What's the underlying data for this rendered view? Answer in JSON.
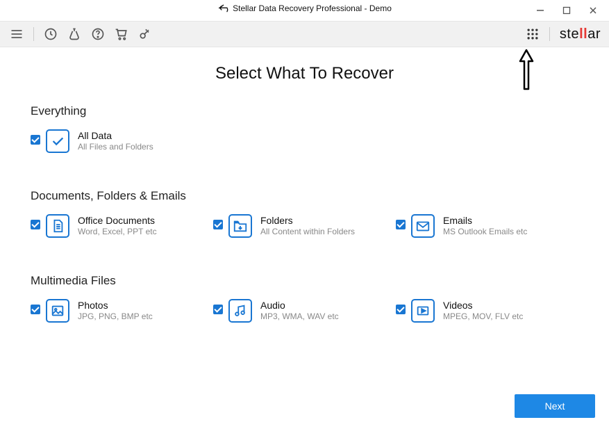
{
  "window": {
    "title": "Stellar Data Recovery Professional - Demo"
  },
  "brand": {
    "pre": "ste",
    "accent": "ll",
    "post": "ar"
  },
  "page": {
    "title": "Select What To Recover"
  },
  "sections": {
    "everything": {
      "title": "Everything",
      "all_data": {
        "title": "All Data",
        "sub": "All Files and Folders",
        "checked": true
      }
    },
    "docs": {
      "title": "Documents, Folders & Emails",
      "office": {
        "title": "Office Documents",
        "sub": "Word, Excel, PPT etc",
        "checked": true
      },
      "folders": {
        "title": "Folders",
        "sub": "All Content within Folders",
        "checked": true
      },
      "emails": {
        "title": "Emails",
        "sub": "MS Outlook Emails etc",
        "checked": true
      }
    },
    "media": {
      "title": "Multimedia Files",
      "photos": {
        "title": "Photos",
        "sub": "JPG, PNG, BMP etc",
        "checked": true
      },
      "audio": {
        "title": "Audio",
        "sub": "MP3, WMA, WAV etc",
        "checked": true
      },
      "videos": {
        "title": "Videos",
        "sub": "MPEG, MOV, FLV etc",
        "checked": true
      }
    }
  },
  "footer": {
    "next": "Next"
  },
  "colors": {
    "accent": "#1976d2",
    "brand_red": "#e53935",
    "button": "#1e88e5"
  }
}
